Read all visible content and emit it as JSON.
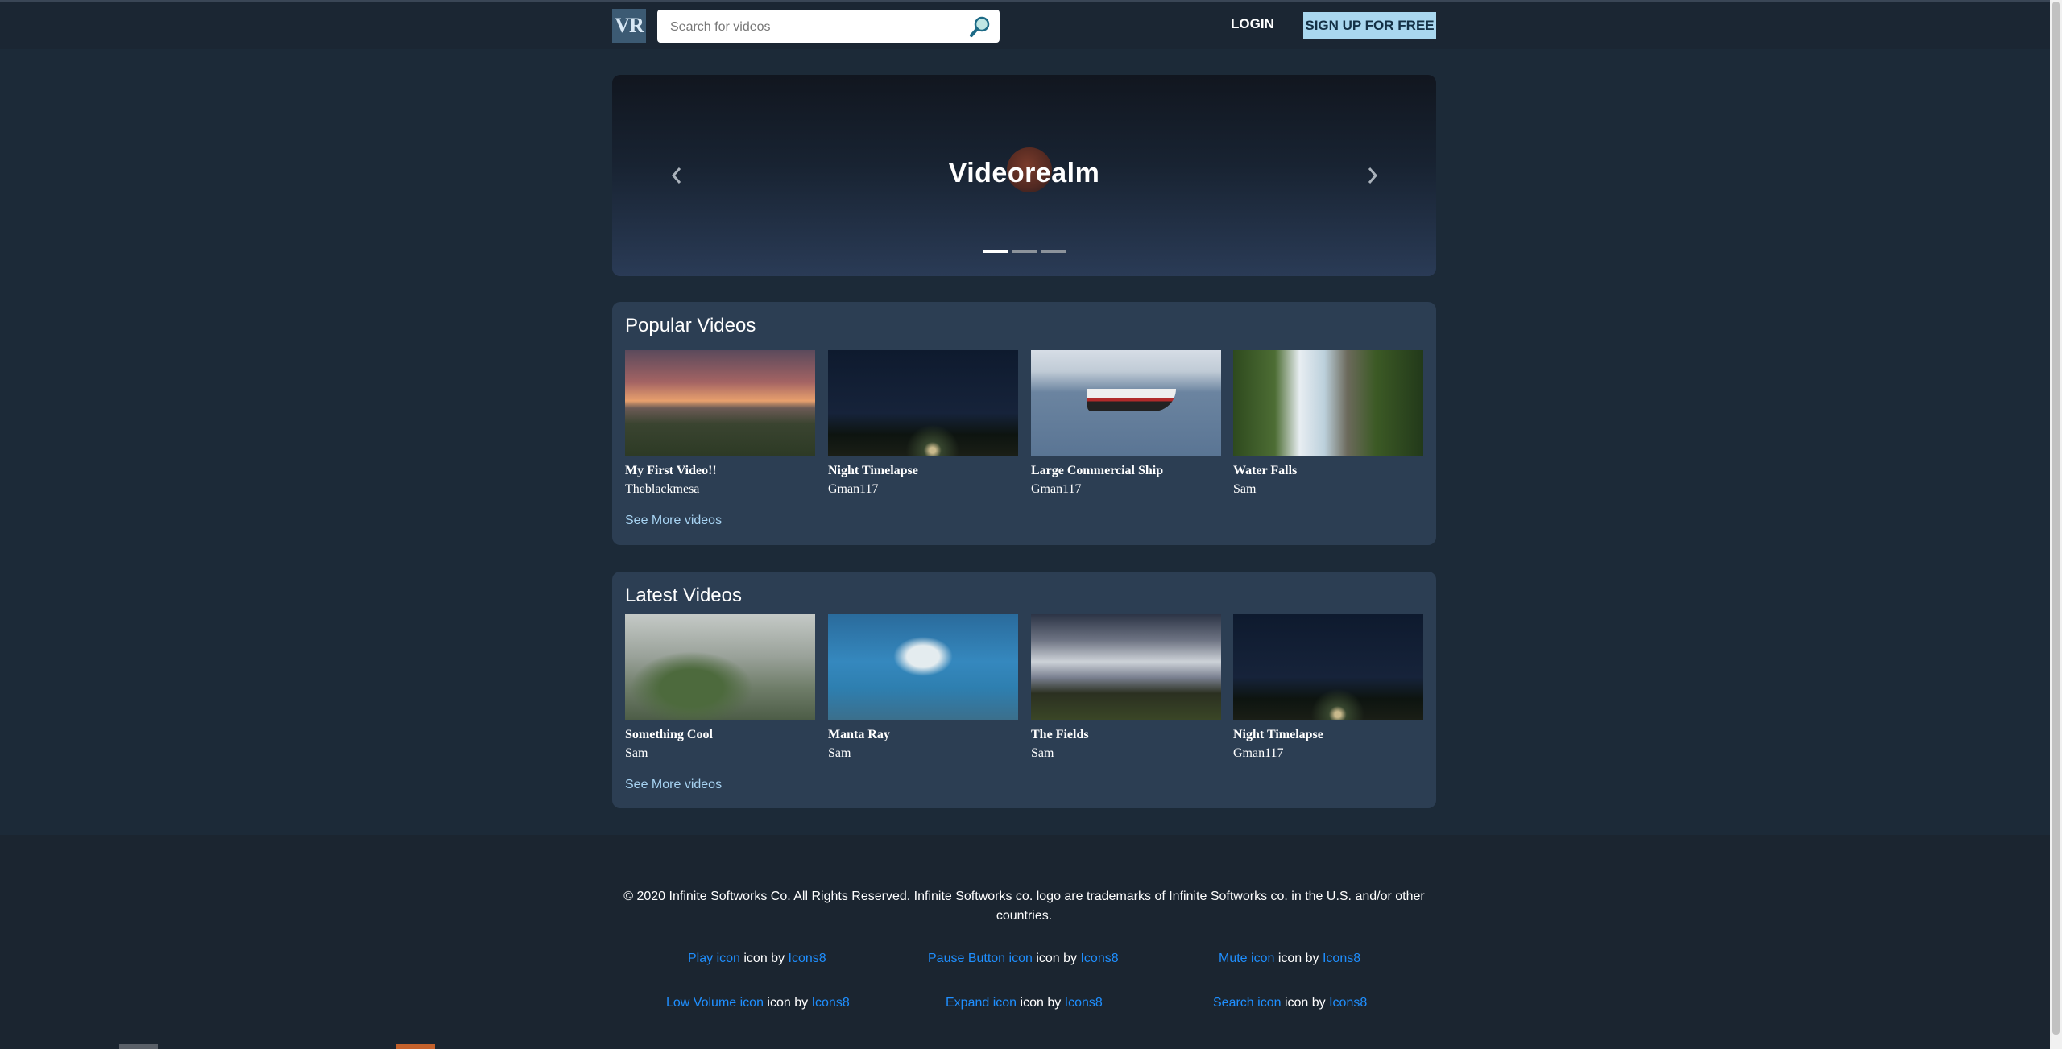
{
  "header": {
    "logo_text": "VR",
    "search_placeholder": "Search for videos",
    "login_label": "LOGIN",
    "signup_label": "SIGN UP FOR FREE"
  },
  "hero": {
    "title": "Videorealm",
    "slide_count": 3,
    "active_slide": 1
  },
  "popular": {
    "title": "Popular Videos",
    "see_more": "See More videos",
    "videos": [
      {
        "title": "My First Video!!",
        "author": "Theblackmesa"
      },
      {
        "title": "Night Timelapse",
        "author": "Gman117"
      },
      {
        "title": "Large Commercial Ship",
        "author": "Gman117"
      },
      {
        "title": "Water Falls",
        "author": "Sam"
      }
    ]
  },
  "latest": {
    "title": "Latest Videos",
    "see_more": "See More videos",
    "videos": [
      {
        "title": "Something Cool",
        "author": "Sam"
      },
      {
        "title": "Manta Ray",
        "author": "Sam"
      },
      {
        "title": "The Fields",
        "author": "Sam"
      },
      {
        "title": "Night Timelapse",
        "author": "Gman117"
      }
    ]
  },
  "footer": {
    "copyright": "© 2020 Infinite Softworks Co. All Rights Reserved. Infinite Softworks co. logo are trademarks of Infinite Softworks co. in the U.S. and/or other countries.",
    "icon_by": "icon by",
    "credits": [
      {
        "icon_link": "Play icon",
        "source": "Icons8"
      },
      {
        "icon_link": "Pause Button icon",
        "source": "Icons8"
      },
      {
        "icon_link": "Mute icon",
        "source": "Icons8"
      },
      {
        "icon_link": "Low Volume icon",
        "source": "Icons8"
      },
      {
        "icon_link": "Expand icon",
        "source": "Icons8"
      },
      {
        "icon_link": "Search icon",
        "source": "Icons8"
      }
    ]
  },
  "colors": {
    "page_bg": "#1c2a38",
    "section_bg": "#2c3e53",
    "accent": "#a9d7ef",
    "link": "#1f8fff"
  }
}
